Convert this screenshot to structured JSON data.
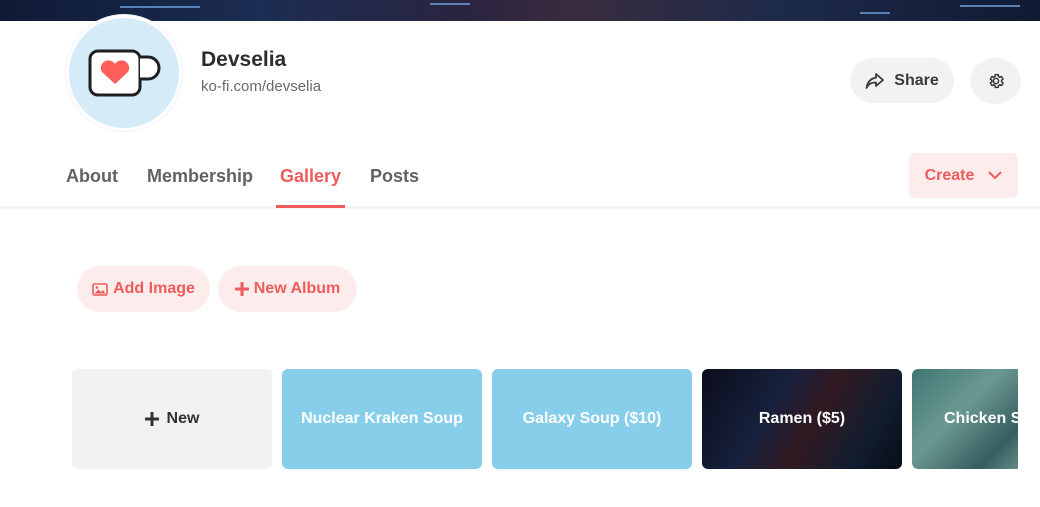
{
  "profile": {
    "name": "Devselia",
    "url": "ko-fi.com/devselia"
  },
  "header": {
    "share_label": "Share"
  },
  "tabs": [
    {
      "label": "About"
    },
    {
      "label": "Membership"
    },
    {
      "label": "Gallery",
      "active": true
    },
    {
      "label": "Posts"
    }
  ],
  "create_label": "Create",
  "actions": {
    "add_image_label": "Add Image",
    "new_album_label": "New Album"
  },
  "gallery": {
    "new_label": "New",
    "albums": [
      {
        "title": "Nuclear Kraken Soup"
      },
      {
        "title": "Galaxy Soup ($10)"
      },
      {
        "title": "Ramen ($5)"
      },
      {
        "title": "Chicken S"
      }
    ]
  },
  "colors": {
    "accent": "#ee5b5b",
    "accent_bg": "#fdecec",
    "album_blue": "#87ceeb",
    "avatar_bg": "#d6ebf8"
  }
}
